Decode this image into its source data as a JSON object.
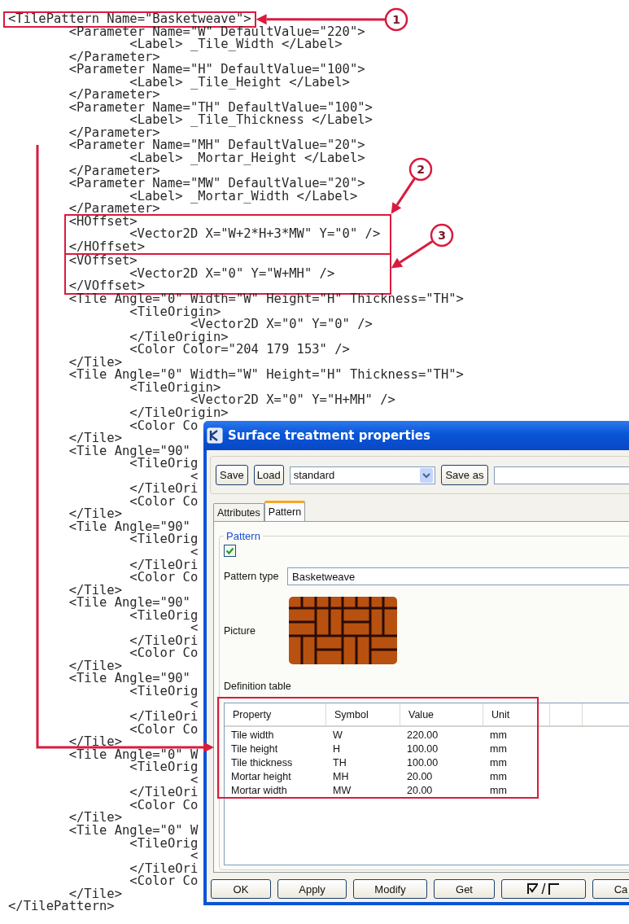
{
  "code_listing": {
    "root": {
      "open": "<TilePattern Name=\"Basketweave\">",
      "open_line_highlighted": true,
      "close": "</TilePattern>",
      "children": [
        {
          "open": "<Parameter Name=\"W\" DefaultValue=\"220\">",
          "children": [
            {
              "open": "<Label> _Tile_Width </Label>"
            }
          ],
          "close": "</Parameter>"
        },
        {
          "open": "<Parameter Name=\"H\" DefaultValue=\"100\">",
          "children": [
            {
              "open": "<Label> _Tile_Height </Label>"
            }
          ],
          "close": "</Parameter>"
        },
        {
          "open": "<Parameter Name=\"TH\" DefaultValue=\"100\">",
          "children": [
            {
              "open": "<Label> _Tile_Thickness </Label>"
            }
          ],
          "close": "</Parameter>"
        },
        {
          "open": "<Parameter Name=\"MH\" DefaultValue=\"20\">",
          "children": [
            {
              "open": "<Label> _Mortar_Height </Label>"
            }
          ],
          "close": "</Parameter>"
        },
        {
          "open": "<Parameter Name=\"MW\" DefaultValue=\"20\">",
          "children": [
            {
              "open": "<Label> _Mortar_Width </Label>"
            }
          ],
          "close": "</Parameter>"
        },
        {
          "open": "<HOffset>",
          "highlighted": true,
          "children": [
            {
              "open": "<Vector2D X=\"W+2*H+3*MW\" Y=\"0\" />"
            }
          ],
          "close": "</HOffset>"
        },
        {
          "open": "<VOffset>",
          "highlighted": true,
          "children": [
            {
              "open": "<Vector2D X=\"0\" Y=\"W+MH\" />"
            }
          ],
          "close": "</VOffset>"
        },
        {
          "open": "<Tile Angle=\"0\" Width=\"W\" Height=\"H\" Thickness=\"TH\">",
          "children": [
            {
              "open": "<TileOrigin>",
              "children": [
                {
                  "open": "<Vector2D X=\"0\" Y=\"0\" />"
                }
              ],
              "close": "</TileOrigin>"
            },
            {
              "open": "<Color Color=\"204 179 153\" />"
            }
          ],
          "close": "</Tile>"
        },
        {
          "open": "<Tile Angle=\"0\" Width=\"W\" Height=\"H\" Thickness=\"TH\">",
          "children": [
            {
              "open": "<TileOrigin>",
              "children": [
                {
                  "open": "<Vector2D X=\"0\" Y=\"H+MH\" />"
                }
              ],
              "close": "</TileOrigin>"
            },
            {
              "open": "<Color Co"
            }
          ],
          "close": "</Tile>"
        },
        {
          "open": "<Tile Angle=\"90\"",
          "children": [
            {
              "open": "<TileOrig",
              "children": [
                {
                  "open": "<"
                }
              ],
              "close": "</TileOri"
            },
            {
              "open": "<Color Co"
            }
          ],
          "close": "</Tile>"
        },
        {
          "open": "<Tile Angle=\"90\"",
          "children": [
            {
              "open": "<TileOrig",
              "children": [
                {
                  "open": "<"
                }
              ],
              "close": "</TileOri"
            },
            {
              "open": "<Color Co"
            }
          ],
          "close": "</Tile>"
        },
        {
          "open": "<Tile Angle=\"90\"",
          "children": [
            {
              "open": "<TileOrig",
              "children": [
                {
                  "open": "<"
                }
              ],
              "close": "</TileOri"
            },
            {
              "open": "<Color Co"
            }
          ],
          "close": "</Tile>"
        },
        {
          "open": "<Tile Angle=\"90\"",
          "children": [
            {
              "open": "<TileOrig",
              "children": [
                {
                  "open": "<"
                }
              ],
              "close": "</TileOri"
            },
            {
              "open": "<Color Co"
            }
          ],
          "close": "</Tile>"
        },
        {
          "open": "<Tile Angle=\"0\" W",
          "children": [
            {
              "open": "<TileOrig",
              "children": [
                {
                  "open": "<"
                }
              ],
              "close": "</TileOri"
            },
            {
              "open": "<Color Co"
            }
          ],
          "close": "</Tile>"
        },
        {
          "open": "<Tile Angle=\"0\" W",
          "children": [
            {
              "open": "<TileOrig",
              "children": [
                {
                  "open": "<"
                }
              ],
              "close": "</TileOri"
            },
            {
              "open": "<Color Co"
            }
          ],
          "close": "</Tile>"
        }
      ]
    }
  },
  "callouts": [
    {
      "number": "1"
    },
    {
      "number": "2"
    },
    {
      "number": "3"
    }
  ],
  "dialog": {
    "title": "Surface treatment properties",
    "toolbar": {
      "save": "Save",
      "load": "Load",
      "preset_value": "standard",
      "save_as": "Save as"
    },
    "tabs": [
      {
        "label": "Attributes",
        "selected": false
      },
      {
        "label": "Pattern",
        "selected": true
      }
    ],
    "pattern_group": {
      "legend": "Pattern",
      "enabled": {
        "checked": true
      },
      "pattern_type": {
        "label": "Pattern type",
        "value": "Basketweave"
      },
      "picture_label": "Picture",
      "definition_label": "Definition table"
    },
    "table": {
      "highlighted": true,
      "columns": [
        "Property",
        "Symbol",
        "Value",
        "Unit"
      ],
      "rows": [
        [
          "Tile width",
          "W",
          "220.00",
          "mm"
        ],
        [
          "Tile height",
          "H",
          "100.00",
          "mm"
        ],
        [
          "Tile thickness",
          "TH",
          "100.00",
          "mm"
        ],
        [
          "Mortar height",
          "MH",
          "20.00",
          "mm"
        ],
        [
          "Mortar width",
          "MW",
          "20.00",
          "mm"
        ]
      ]
    },
    "buttons": [
      {
        "kind": "text",
        "label": "OK"
      },
      {
        "kind": "text",
        "label": "Apply"
      },
      {
        "kind": "text",
        "label": "Modify"
      },
      {
        "kind": "text",
        "label": "Get"
      },
      {
        "kind": "toggle",
        "label": "/"
      },
      {
        "kind": "text",
        "label": "Ca"
      }
    ]
  }
}
